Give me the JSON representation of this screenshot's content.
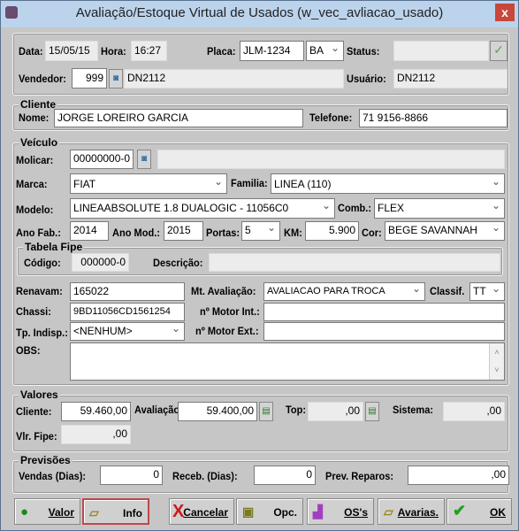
{
  "window": {
    "title": "Avaliação/Estoque Virtual de Usados (w_vec_avliacao_usado)",
    "close": "x"
  },
  "header": {
    "data_label": "Data:",
    "data": "15/05/15",
    "hora_label": "Hora:",
    "hora": "16:27",
    "placa_label": "Placa:",
    "placa": "JLM-1234",
    "uf": "BA",
    "status_label": "Status:",
    "status": "",
    "vendedor_label": "Vendedor:",
    "vendedor_code": "999",
    "vendedor_name": "DN2112",
    "usuario_label": "Usuário:",
    "usuario": "DN2112"
  },
  "cliente": {
    "group": "Cliente",
    "nome_label": "Nome:",
    "nome": "JORGE LOREIRO GARCIA",
    "telefone_label": "Telefone:",
    "telefone": "71 9156-8866"
  },
  "veiculo": {
    "group": "Veículo",
    "molicar_label": "Molicar:",
    "molicar": "00000000-0",
    "molicar_desc": "",
    "marca_label": "Marca:",
    "marca": "FIAT",
    "familia_label": "Familia:",
    "familia": "LINEA (110)",
    "modelo_label": "Modelo:",
    "modelo": "LINEAABSOLUTE 1.8 DUALOGIC - 11056C0",
    "comb_label": "Comb.:",
    "comb": "FLEX",
    "anofab_label": "Ano Fab.:",
    "anofab": "2014",
    "anomod_label": "Ano Mod.:",
    "anomod": "2015",
    "portas_label": "Portas:",
    "portas": "5",
    "km_label": "KM:",
    "km": "5.900",
    "cor_label": "Cor:",
    "cor": "BEGE SAVANNAH",
    "fipe": {
      "group": "Tabela Fipe",
      "codigo_label": "Código:",
      "codigo": "000000-0",
      "descricao_label": "Descrição:",
      "descricao": ""
    },
    "renavam_label": "Renavam:",
    "renavam": "165022",
    "mt_label": "Mt. Avaliação:",
    "mt": "AVALIACAO PARA TROCA",
    "classif_label": "Classif.",
    "classif": "TT",
    "chassi_label": "Chassi:",
    "chassi": "9BD11056CD1561254",
    "motorint_label": "nº Motor Int.:",
    "motorint": "",
    "tpindisp_label": "Tp. Indisp.:",
    "tpindisp": "<NENHUM>",
    "motorext_label": "nº Motor Ext.:",
    "motorext": "",
    "obs_label": "OBS:",
    "obs": ""
  },
  "valores": {
    "group": "Valores",
    "cliente_label": "Cliente:",
    "cliente": "59.460,00",
    "avaliacao_label": "Avaliação:",
    "avaliacao": "59.400,00",
    "top_label": "Top:",
    "top": ",00",
    "sistema_label": "Sistema:",
    "sistema": ",00",
    "fipe_label": "Vlr. Fipe:",
    "fipe": ",00"
  },
  "previsoes": {
    "group": "Previsões",
    "vendas_label": "Vendas (Dias):",
    "vendas": "0",
    "receb_label": "Receb. (Dias):",
    "receb": "0",
    "reparos_label": "Prev. Reparos:",
    "reparos": ",00"
  },
  "buttons": [
    "Valor",
    "Info",
    "Cancelar",
    "Opc.",
    "OS's",
    "Avarias.",
    "OK"
  ]
}
